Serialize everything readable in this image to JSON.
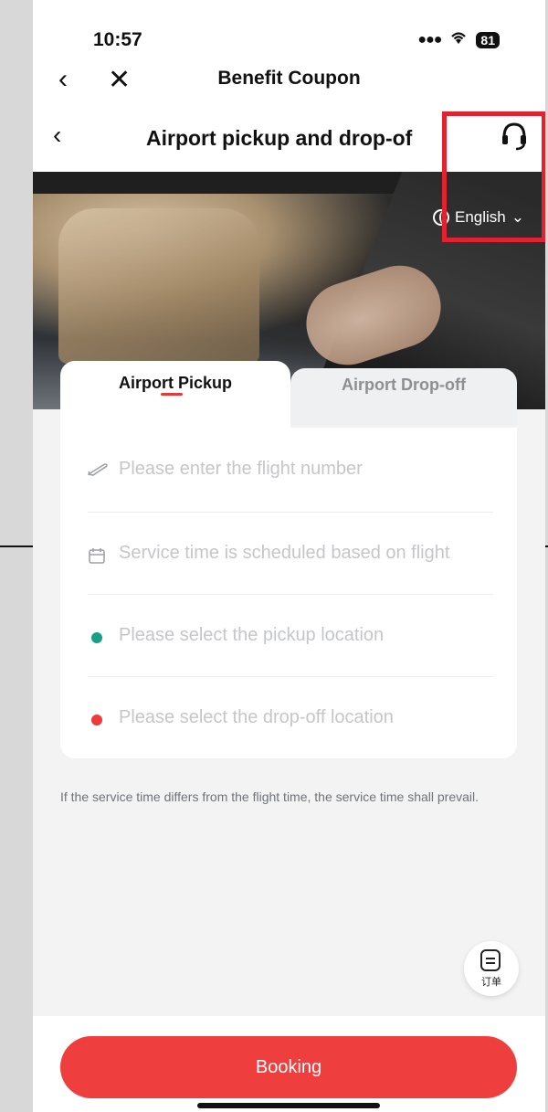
{
  "status": {
    "time": "10:57",
    "battery": "81"
  },
  "nav": {
    "title": "Benefit Coupon"
  },
  "page": {
    "title": "Airport pickup and drop-of",
    "language": "English"
  },
  "tabs": [
    {
      "label": "Airport Pickup",
      "active": true
    },
    {
      "label": "Airport Drop-off",
      "active": false
    }
  ],
  "form": {
    "flight_placeholder": "Please enter the flight number",
    "service_time_placeholder": "Service time is scheduled based on flight",
    "pickup_placeholder": "Please select the pickup location",
    "dropoff_placeholder": "Please select the drop-off location"
  },
  "note": "If the service time differs from the flight time, the service time shall prevail.",
  "order_button": {
    "label": "订单"
  },
  "booking_button": {
    "label": "Booking"
  },
  "colors": {
    "accent": "#ef3e3e",
    "pickup_dot": "#16a085",
    "dropoff_dot": "#ee3a3a",
    "highlight_box": "#e3222f"
  }
}
